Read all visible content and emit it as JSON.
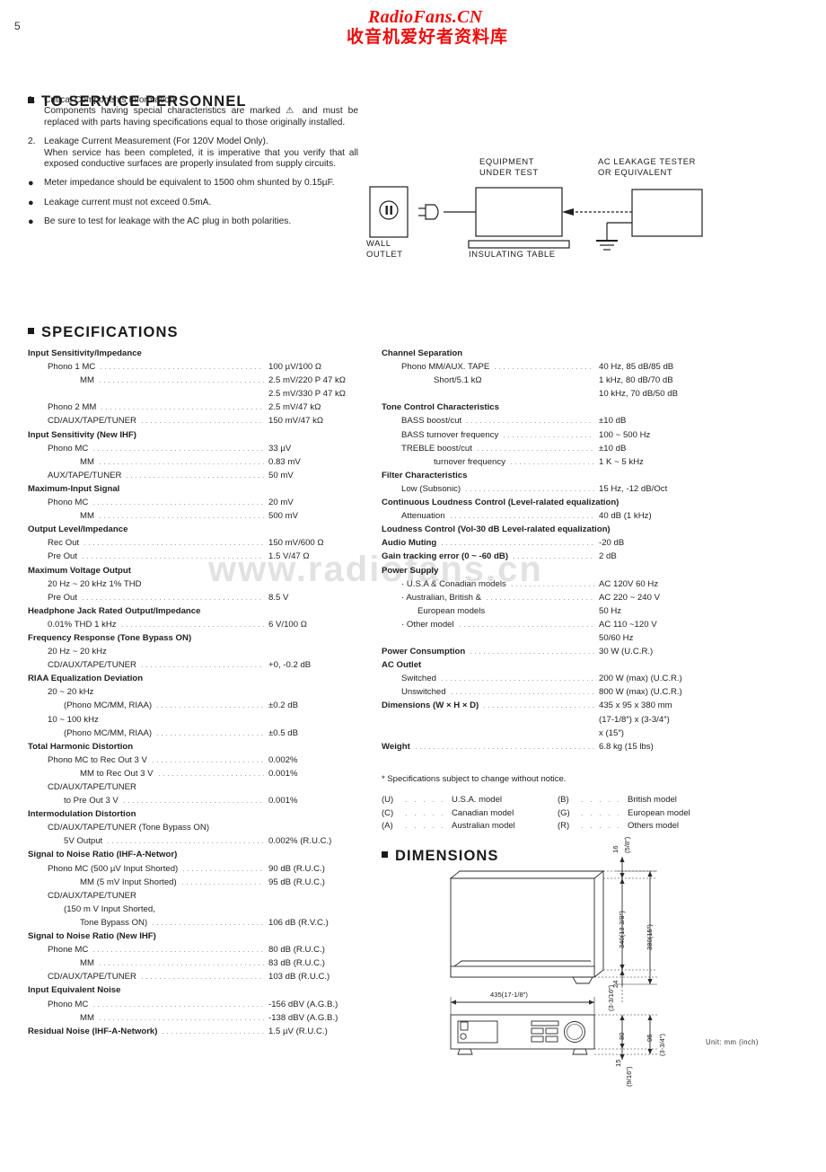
{
  "page": {
    "number": "5"
  },
  "watermark": {
    "latin": "RadioFans.CN",
    "cjk": "收音机爱好者资料库",
    "diagonal": "www.radiofans.cn"
  },
  "service": {
    "heading": "TO SERVICE PERSONNEL",
    "notes": [
      {
        "marker": "1.",
        "lines": [
          "Critical Components Information.",
          "Components having special characteristics are marked ⚠ and must be replaced with parts having specifications equal to those originally installed."
        ]
      },
      {
        "marker": "2.",
        "lines": [
          "Leakage Current Measurement (For 120V Model Only).",
          "When service has been completed, it is imperative that you verify that all exposed conductive surfaces are properly insulated from supply circuits."
        ]
      },
      {
        "marker": "●",
        "lines": [
          "Meter impedance should be equivalent to 1500 ohm shunted by 0.15µF."
        ]
      },
      {
        "marker": "●",
        "lines": [
          "Leakage current must not exceed 0.5mA."
        ]
      },
      {
        "marker": "●",
        "lines": [
          "Be sure to test for leakage with the AC plug in both polarities."
        ]
      }
    ]
  },
  "leakage_diagram": {
    "wall_outlet": "WALL\nOUTLET",
    "wall_outlet_line1": "WALL",
    "wall_outlet_line2": "OUTLET",
    "equipment_line1": "EQUIPMENT",
    "equipment_line2": "UNDER TEST",
    "tester_line1": "AC LEAKAGE TESTER",
    "tester_line2": "OR EQUIVALENT",
    "insulating_table": "INSULATING TABLE"
  },
  "specifications": {
    "heading": "SPECIFICATIONS",
    "left": [
      {
        "level": 0,
        "label": "Input Sensitivity/Impedance",
        "value": "",
        "dots": false
      },
      {
        "level": 1,
        "label": "Phono 1 MC",
        "value": "100 µV/100 Ω",
        "dots": true
      },
      {
        "level": 3,
        "label": "MM",
        "value": "2.5 mV/220 P 47 kΩ",
        "dots": true
      },
      {
        "level": 3,
        "label": "",
        "value": "2.5 mV/330 P 47 kΩ",
        "dots": false
      },
      {
        "level": 1,
        "label": "Phono 2 MM",
        "value": "2.5 mV/47 kΩ",
        "dots": true
      },
      {
        "level": 1,
        "label": "CD/AUX/TAPE/TUNER",
        "value": "150 mV/47 kΩ",
        "dots": true
      },
      {
        "level": 0,
        "label": "Input Sensitivity (New IHF)",
        "value": "",
        "dots": false
      },
      {
        "level": 1,
        "label": "Phono MC",
        "value": "33 µV",
        "dots": true
      },
      {
        "level": 3,
        "label": "MM",
        "value": "0.83 mV",
        "dots": true
      },
      {
        "level": 1,
        "label": "AUX/TAPE/TUNER",
        "value": "50 mV",
        "dots": true
      },
      {
        "level": 0,
        "label": "Maximum-Input Signal",
        "value": "",
        "dots": false
      },
      {
        "level": 1,
        "label": "Phono MC",
        "value": "20 mV",
        "dots": true
      },
      {
        "level": 3,
        "label": "MM",
        "value": "500 mV",
        "dots": true
      },
      {
        "level": 0,
        "label": "Output Level/Impedance",
        "value": "",
        "dots": false
      },
      {
        "level": 1,
        "label": "Rec Out",
        "value": "150 mV/600 Ω",
        "dots": true
      },
      {
        "level": 1,
        "label": "Pre Out",
        "value": "1.5 V/47 Ω",
        "dots": true
      },
      {
        "level": 0,
        "label": "Maximum Voltage Output",
        "value": "",
        "dots": false
      },
      {
        "level": 1,
        "label": "20 Hz ~ 20 kHz 1% THD",
        "value": "",
        "dots": false
      },
      {
        "level": 1,
        "label": "Pre Out",
        "value": "8.5 V",
        "dots": true
      },
      {
        "level": 0,
        "label": "Headphone Jack Rated Output/Impedance",
        "value": "",
        "dots": false
      },
      {
        "level": 1,
        "label": "0.01% THD 1 kHz",
        "value": "6 V/100 Ω",
        "dots": true
      },
      {
        "level": 0,
        "label": "Frequency Response (Tone Bypass ON)",
        "value": "",
        "dots": false
      },
      {
        "level": 1,
        "label": "20 Hz ~ 20 kHz",
        "value": "",
        "dots": false
      },
      {
        "level": 1,
        "label": "CD/AUX/TAPE/TUNER",
        "value": "+0, -0.2 dB",
        "dots": true
      },
      {
        "level": 0,
        "label": "RIAA Equalization Deviation",
        "value": "",
        "dots": false
      },
      {
        "level": 1,
        "label": "20 ~ 20 kHz",
        "value": "",
        "dots": false
      },
      {
        "level": 2,
        "label": "(Phono MC/MM, RIAA)",
        "value": "±0.2 dB",
        "dots": true
      },
      {
        "level": 1,
        "label": "10 ~ 100 kHz",
        "value": "",
        "dots": false
      },
      {
        "level": 2,
        "label": "(Phono MC/MM, RIAA)",
        "value": "±0.5 dB",
        "dots": true
      },
      {
        "level": 0,
        "label": "Total Harmonic Distortion",
        "value": "",
        "dots": false
      },
      {
        "level": 1,
        "label": "Phono MC to Rec Out 3 V",
        "value": "0.002%",
        "dots": true
      },
      {
        "level": 3,
        "label": "MM to Rec Out 3 V",
        "value": "0.001%",
        "dots": true
      },
      {
        "level": 1,
        "label": "CD/AUX/TAPE/TUNER",
        "value": "",
        "dots": false
      },
      {
        "level": 2,
        "label": "to Pre Out 3 V",
        "value": "0.001%",
        "dots": true
      },
      {
        "level": 0,
        "label": "Intermodulation Distortion",
        "value": "",
        "dots": false
      },
      {
        "level": 1,
        "label": "CD/AUX/TAPE/TUNER  (Tone Bypass ON)",
        "value": "",
        "dots": false
      },
      {
        "level": 2,
        "label": "5V Output",
        "value": "0.002% (R.U.C.)",
        "dots": true
      },
      {
        "level": 0,
        "label": "Signal to Noise Ratio (IHF-A-Networ)",
        "value": "",
        "dots": false
      },
      {
        "level": 1,
        "label": "Phono MC (500 µV Input Shorted)",
        "value": "90 dB (R.U.C.)",
        "dots": true
      },
      {
        "level": 3,
        "label": "MM (5 mV Input Shorted)",
        "value": "95 dB (R.U.C.)",
        "dots": true
      },
      {
        "level": 1,
        "label": "CD/AUX/TAPE/TUNER",
        "value": "",
        "dots": false
      },
      {
        "level": 2,
        "label": "(150 m V Input Shorted,",
        "value": "",
        "dots": false
      },
      {
        "level": 3,
        "label": "Tone Bypass ON)",
        "value": "106 dB (R.V.C.)",
        "dots": true
      },
      {
        "level": 0,
        "label": "Signal to Noise Ratio (New IHF)",
        "value": "",
        "dots": false
      },
      {
        "level": 1,
        "label": "Phone MC",
        "value": "80 dB (R.U.C.)",
        "dots": true
      },
      {
        "level": 3,
        "label": "MM",
        "value": "83 dB (R.U.C.)",
        "dots": true
      },
      {
        "level": 1,
        "label": "CD/AUX/TAPE/TUNER",
        "value": "103 dB (R.U.C.)",
        "dots": true
      },
      {
        "level": 0,
        "label": "Input Equivalent Noise",
        "value": "",
        "dots": false
      },
      {
        "level": 1,
        "label": "Phono MC",
        "value": "-156 dBV (A.G.B.)",
        "dots": true
      },
      {
        "level": 3,
        "label": "MM",
        "value": "-138 dBV (A.G.B.)",
        "dots": true
      },
      {
        "level": 0,
        "label": "Residual Noise (IHF-A-Network)",
        "value": "1.5 µV (R.U.C.)",
        "dots": true
      }
    ],
    "right": [
      {
        "level": 0,
        "label": "Channel Separation",
        "value": "",
        "dots": false
      },
      {
        "level": 1,
        "label": "Phono MM/AUX. TAPE",
        "value": "40 Hz, 85 dB/85 dB",
        "dots": true
      },
      {
        "level": 3,
        "label": "Short/5.1 kΩ",
        "value": "1 kHz, 80 dB/70 dB",
        "dots": false
      },
      {
        "level": 3,
        "label": "",
        "value": "10 kHz, 70 dB/50 dB",
        "dots": false
      },
      {
        "level": 0,
        "label": "Tone Control Characteristics",
        "value": "",
        "dots": false
      },
      {
        "level": 1,
        "label": "BASS boost/cut",
        "value": "±10 dB",
        "dots": true
      },
      {
        "level": 1,
        "label": "BASS turnover frequency",
        "value": "100 ~ 500 Hz",
        "dots": true
      },
      {
        "level": 1,
        "label": "TREBLE boost/cut",
        "value": "±10 dB",
        "dots": true
      },
      {
        "level": 3,
        "label": "turnover frequency",
        "value": "1 K ~ 5 kHz",
        "dots": true
      },
      {
        "level": 0,
        "label": "Filter Characteristics",
        "value": "",
        "dots": false
      },
      {
        "level": 1,
        "label": "Low (Subsonic)",
        "value": "15 Hz, -12 dB/Oct",
        "dots": true
      },
      {
        "level": 0,
        "label": "Continuous Loudness Control (Level-ralated equalization)",
        "value": "",
        "dots": false
      },
      {
        "level": 1,
        "label": "Attenuation",
        "value": "40 dB (1 kHz)",
        "dots": true
      },
      {
        "level": 0,
        "label": "Loudness Control (Vol-30 dB Level-ralated equalization)",
        "value": "",
        "dots": false
      },
      {
        "level": 0,
        "label": "Audio Muting",
        "value": "-20 dB",
        "dots": true
      },
      {
        "level": 0,
        "label": "Gain tracking error (0 ~ -60 dB)",
        "value": "2 dB",
        "dots": true
      },
      {
        "level": 0,
        "label": "Power Supply",
        "value": "",
        "dots": false
      },
      {
        "level": 1,
        "label": "· U.S.A & Conadian models",
        "value": "AC 120V 60 Hz",
        "dots": true
      },
      {
        "level": 1,
        "label": "· Australian, British &",
        "value": "AC 220 ~ 240 V",
        "dots": true
      },
      {
        "level": 2,
        "label": "European models",
        "value": "50 Hz",
        "dots": false
      },
      {
        "level": 1,
        "label": "· Other model",
        "value": "AC 110 ~120 V",
        "dots": true
      },
      {
        "level": 2,
        "label": "",
        "value": "50/60 Hz",
        "dots": false
      },
      {
        "level": 0,
        "label": "Power Consumption",
        "value": "30 W (U.C.R.)",
        "dots": true
      },
      {
        "level": 0,
        "label": "AC Outlet",
        "value": "",
        "dots": false
      },
      {
        "level": 1,
        "label": "Switched",
        "value": "200 W (max) (U.C.R.)",
        "dots": true
      },
      {
        "level": 1,
        "label": "Unswitched",
        "value": "800 W (max) (U.C.R.)",
        "dots": true
      },
      {
        "level": 0,
        "label": "Dimensions (W × H × D)",
        "value": "435 x 95 x 380 mm",
        "dots": true
      },
      {
        "level": 0,
        "label": "",
        "value": "(17-1/8″) x (3-3/4″)",
        "dots": false
      },
      {
        "level": 0,
        "label": "",
        "value": "x (15″)",
        "dots": false
      },
      {
        "level": 0,
        "label": "Weight",
        "value": "6.8 kg (15 lbs)",
        "dots": true
      }
    ],
    "footnote": "* Specifications subject to change without notice.",
    "model_legend": [
      {
        "code": "(U)",
        "name": "U.S.A. model",
        "code2": "(B)",
        "name2": "British model"
      },
      {
        "code": "(C)",
        "name": "Canadian model",
        "code2": "(G)",
        "name2": "European model"
      },
      {
        "code": "(A)",
        "name": "Australian model",
        "code2": "(R)",
        "name2": "Others model"
      }
    ]
  },
  "dimensions": {
    "heading": "DIMENSIONS",
    "width_label": "435(17-1/8″)",
    "depth_inner_label": "340(13-3/8″)",
    "depth_total_label": "380(15″)",
    "top_offset_label": "16",
    "top_offset_inch": "(5/8″)",
    "rear_offset_label": "24",
    "height_body_label": "80",
    "height_body_inch": "(3-3/16″)",
    "height_total_label": "95",
    "height_total_inch": "(3-3/4″)",
    "foot_label": "15",
    "foot_inch": "(9/16″)",
    "unit_note": "Unit: mm (inch)"
  }
}
